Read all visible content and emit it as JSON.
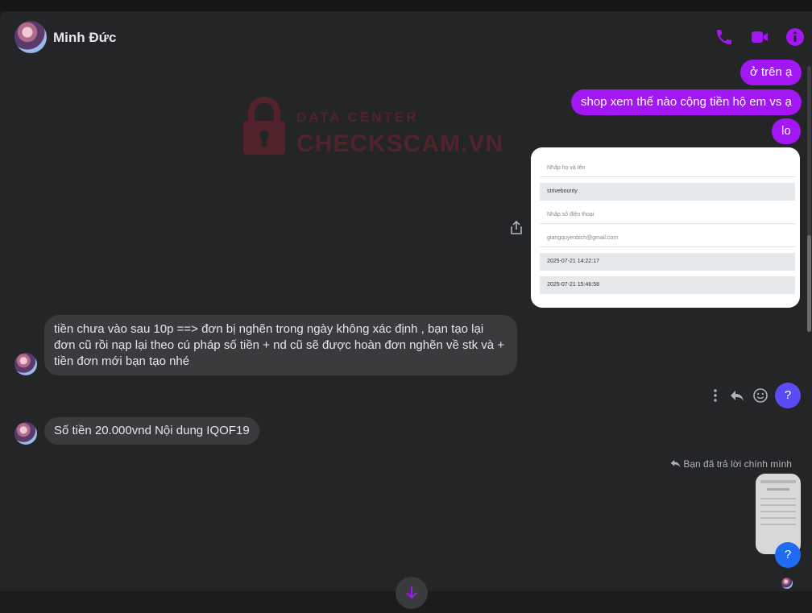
{
  "contact": {
    "name": "Minh Đức"
  },
  "header_icons": [
    "phone-icon",
    "video-camera-icon",
    "info-icon"
  ],
  "watermark": {
    "line1": "DATA CENTER",
    "line2": "CHECKSCAM.VN"
  },
  "messages_outgoing": [
    "ở trên ạ",
    "shop xem thế nào cộng tiền hộ em vs ạ",
    "lo"
  ],
  "form_card": {
    "rows": [
      "Nhập họ và tên",
      "strivebounty",
      "Nhập số điện thoại",
      "giangquyenbich@gmail.com",
      "2025-07-21 14:22:17",
      "2025-07-21 15:46:58"
    ]
  },
  "messages_incoming": {
    "first_lines": [
      "tiền chưa vào sau 10p ==> đơn bị nghẽn trong ngày không xác định , bạn tạo lại",
      "đơn cũ rồi nạp lại theo cú pháp số tiền + nd cũ sẽ được hoàn đơn nghẽn về stk và +",
      "tiền đơn mới bạn tạo nhé"
    ],
    "second": "Số tiền 20.000vnd Nội dung IQOF19"
  },
  "reaction_button": "?",
  "reply": {
    "label": "Bạn đã trả lời chính mình",
    "reaction": "?"
  },
  "colors": {
    "accent": "#a317f4",
    "background": "#242526",
    "incoming_bubble": "#3a3b3c",
    "reaction_purple": "#5b4bf5",
    "reaction_blue": "#1f6cf2"
  }
}
